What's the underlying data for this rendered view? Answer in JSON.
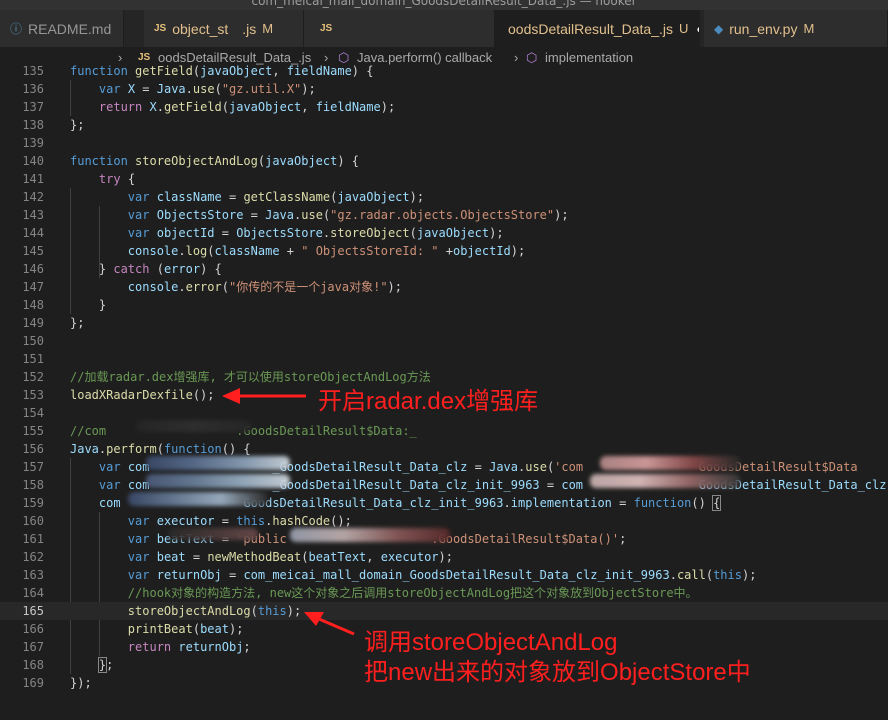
{
  "window": {
    "title": "com_meicai_mall_domain_GoodsDetailResult_Data_.js — hooker"
  },
  "tabs": [
    {
      "label": "README.md",
      "icon": "info-icon",
      "active": false,
      "modified": ""
    },
    {
      "label": "object_st",
      "label_tail": ".js",
      "icon": "js-file-icon",
      "active": false,
      "modified": "M"
    },
    {
      "label": "",
      "icon": "js-file-icon",
      "active": false,
      "modified": ""
    },
    {
      "label": "oodsDetailResult_Data_.js",
      "icon": "",
      "active": true,
      "modified": "U"
    },
    {
      "label": "run_env.py",
      "icon": "python-file-icon",
      "active": false,
      "modified": "M"
    }
  ],
  "breadcrumb": {
    "file_icon": "JS",
    "file": "oodsDetailResult_Data_.js",
    "callback": "Java.perform() callback",
    "method": "implementation"
  },
  "code": {
    "current_line": 165,
    "lines": [
      {
        "n": "135",
        "html": "<span class=\"kw\">function</span> <span class=\"fn\">getField</span>(<span class=\"vr\">javaObject</span>, <span class=\"vr\">fieldName</span>) {"
      },
      {
        "n": "136",
        "html": "    <span class=\"kw\">var</span> <span class=\"vr\">X</span> = <span class=\"vr\">Java</span>.<span class=\"fn\">use</span>(<span class=\"st\">\"gz.util.X\"</span>);"
      },
      {
        "n": "137",
        "html": "    <span class=\"cf\">return</span> <span class=\"vr\">X</span>.<span class=\"fn\">getField</span>(<span class=\"vr\">javaObject</span>, <span class=\"vr\">fieldName</span>);"
      },
      {
        "n": "138",
        "html": "};"
      },
      {
        "n": "139",
        "html": ""
      },
      {
        "n": "140",
        "html": "<span class=\"kw\">function</span> <span class=\"fn\">storeObjectAndLog</span>(<span class=\"vr\">javaObject</span>) {"
      },
      {
        "n": "141",
        "html": "    <span class=\"cf\">try</span> {"
      },
      {
        "n": "142",
        "html": "        <span class=\"kw\">var</span> <span class=\"vr\">className</span> = <span class=\"fn\">getClassName</span>(<span class=\"vr\">javaObject</span>);"
      },
      {
        "n": "143",
        "html": "        <span class=\"kw\">var</span> <span class=\"vr\">ObjectsStore</span> = <span class=\"vr\">Java</span>.<span class=\"fn\">use</span>(<span class=\"st\">\"gz.radar.objects.ObjectsStore\"</span>);"
      },
      {
        "n": "144",
        "html": "        <span class=\"kw\">var</span> <span class=\"vr\">objectId</span> = <span class=\"vr\">ObjectsStore</span>.<span class=\"fn\">storeObject</span>(<span class=\"vr\">javaObject</span>);"
      },
      {
        "n": "145",
        "html": "        <span class=\"vr\">console</span>.<span class=\"fn\">log</span>(<span class=\"vr\">className</span> + <span class=\"st\">\" ObjectsStoreId: \"</span> +<span class=\"vr\">objectId</span>);"
      },
      {
        "n": "146",
        "html": "    } <span class=\"cf\">catch</span> (<span class=\"vr\">error</span>) {"
      },
      {
        "n": "147",
        "html": "        <span class=\"vr\">console</span>.<span class=\"fn\">error</span>(<span class=\"st\">\"你传的不是一个java对象!\"</span>);"
      },
      {
        "n": "148",
        "html": "    }"
      },
      {
        "n": "149",
        "html": "};"
      },
      {
        "n": "150",
        "html": ""
      },
      {
        "n": "151",
        "html": ""
      },
      {
        "n": "152",
        "html": "<span class=\"cm\">//加载radar.dex增强库, 才可以使用storeObjectAndLog方法</span>"
      },
      {
        "n": "153",
        "html": "<span class=\"fn\">loadXRadarDexfile</span>();"
      },
      {
        "n": "154",
        "html": ""
      },
      {
        "n": "155",
        "html": "<span class=\"cm\">//com                  .GoodsDetailResult$Data:_</span>"
      },
      {
        "n": "156",
        "html": "<span class=\"vr\">Java</span>.<span class=\"fn\">perform</span>(<span class=\"kw\">function</span>() {"
      },
      {
        "n": "157",
        "html": "    <span class=\"kw\">var</span> <span class=\"vr\">com</span>                 <span class=\"vr\">_GoodsDetailResult_Data_clz</span> = <span class=\"vr\">Java</span>.<span class=\"fn\">use</span>(<span class=\"st\">'com</span>                <span class=\"st\">GoodsDetailResult$Data</span>"
      },
      {
        "n": "158",
        "html": "    <span class=\"kw\">var</span> <span class=\"vr\">com</span>                 <span class=\"vr\">_GoodsDetailResult_Data_clz_init_9963</span> = <span class=\"vr\">com</span>                <span class=\"vr\">GoodsDetailResult_Data_clz</span>"
      },
      {
        "n": "159",
        "html": "    <span class=\"vr\">com</span>                 <span class=\"vr\">GoodsDetailResult_Data_clz_init_9963</span>.<span class=\"vr\">implementation</span> = <span class=\"kw\">function</span>() <span class=\"bm\">{</span>"
      },
      {
        "n": "160",
        "html": "        <span class=\"kw\">var</span> <span class=\"vr\">executor</span> = <span class=\"kw\">this</span>.<span class=\"fn\">hashCode</span>();"
      },
      {
        "n": "161",
        "html": "        <span class=\"kw\">var</span> <span class=\"vr\">beatText</span> = <span class=\"st\">'public                    .GoodsDetailResult$Data()'</span>;"
      },
      {
        "n": "162",
        "html": "        <span class=\"kw\">var</span> <span class=\"vr\">beat</span> = <span class=\"fn\">newMethodBeat</span>(<span class=\"vr\">beatText</span>, <span class=\"vr\">executor</span>);"
      },
      {
        "n": "163",
        "html": "        <span class=\"kw\">var</span> <span class=\"vr\">returnObj</span> = <span class=\"vr\">com_meicai_mall_domain_GoodsDetailResult_Data_clz_init_9963</span>.<span class=\"fn\">call</span>(<span class=\"kw\">this</span>);"
      },
      {
        "n": "164",
        "html": "        <span class=\"cm\">//hook对象的构造方法, new这个对象之后调用storeObjectAndLog把这个对象放到ObjectStore中。</span>"
      },
      {
        "n": "165",
        "html": "        <span class=\"fn\">storeObjectAndLog</span>(<span class=\"kw\">this</span>);"
      },
      {
        "n": "166",
        "html": "        <span class=\"fn\">printBeat</span>(<span class=\"vr\">beat</span>);"
      },
      {
        "n": "167",
        "html": "        <span class=\"cf\">return</span> <span class=\"vr\">returnObj</span>;"
      },
      {
        "n": "168",
        "html": "    <span class=\"bm\">}</span>;"
      },
      {
        "n": "169",
        "html": "});"
      }
    ]
  },
  "annotations": {
    "a1": "开启radar.dex增强库",
    "a2_line1": "调用storeObjectAndLog",
    "a2_line2": "把new出来的对象放到ObjectStore中"
  },
  "colors": {
    "annotation": "#ff1f1f",
    "editor_bg": "#1e1e1e"
  }
}
